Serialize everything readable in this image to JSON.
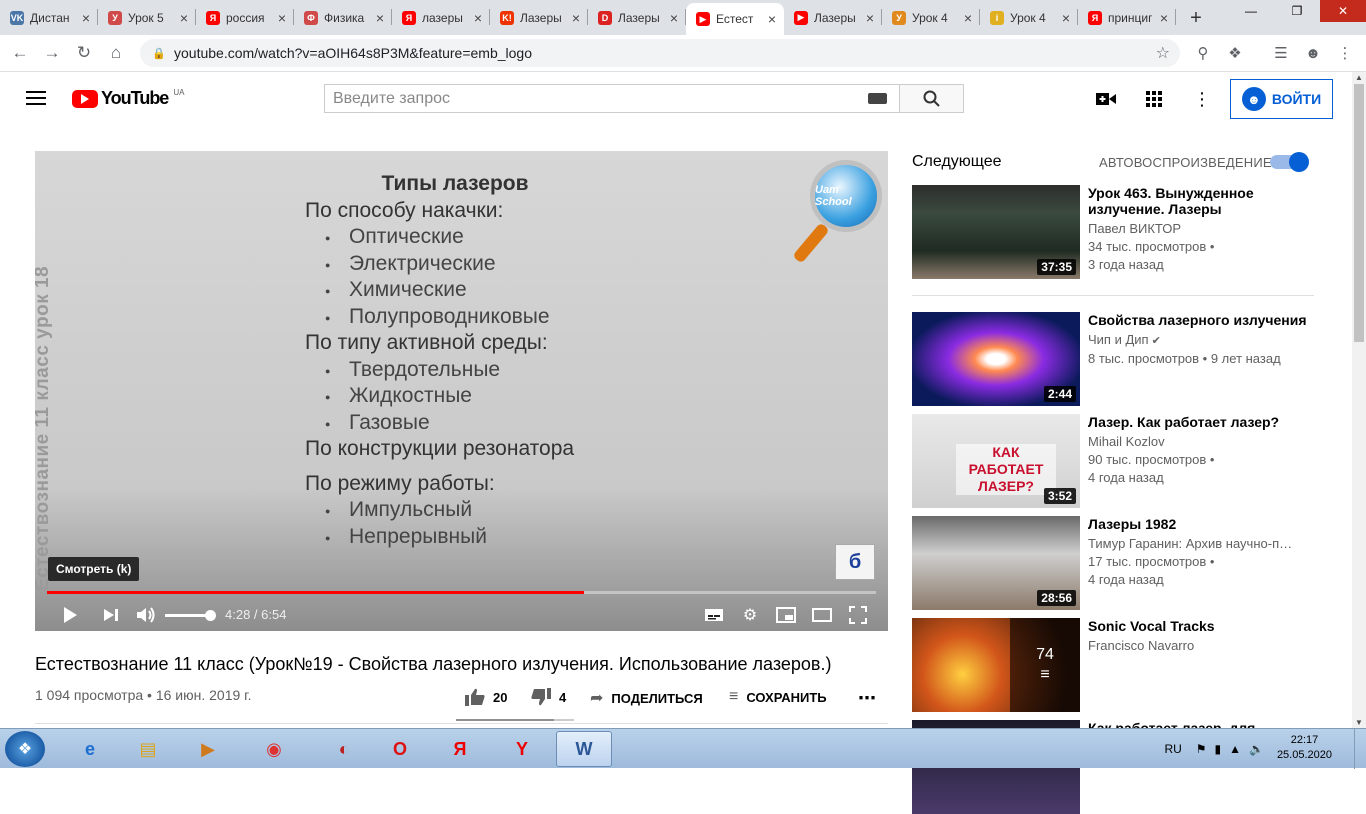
{
  "browser": {
    "tabs": [
      {
        "label": "Дистан",
        "icon": "vk-icon",
        "color": "#4a76a8",
        "glyph": "VK"
      },
      {
        "label": "Урок 5",
        "icon": "lesson-icon",
        "color": "#d04a4a",
        "glyph": "У"
      },
      {
        "label": "россия",
        "icon": "yandex-icon",
        "color": "#f00",
        "glyph": "Я"
      },
      {
        "label": "Физика",
        "icon": "lesson-icon",
        "color": "#d04a4a",
        "glyph": "Ф"
      },
      {
        "label": "лазеры",
        "icon": "yandex-icon",
        "color": "#f00",
        "glyph": "Я"
      },
      {
        "label": "Лазеры",
        "icon": "kinopoisk-icon",
        "color": "#e30",
        "glyph": "K!"
      },
      {
        "label": "Лазеры",
        "icon": "d-icon",
        "color": "#d22",
        "glyph": "D"
      },
      {
        "label": "Естест",
        "icon": "youtube-icon",
        "color": "#f00",
        "glyph": "▶",
        "active": true
      },
      {
        "label": "Лазеры",
        "icon": "youtube-icon",
        "color": "#f00",
        "glyph": "▶"
      },
      {
        "label": "Урок 4",
        "icon": "lesson-icon",
        "color": "#e08a1e",
        "glyph": "У"
      },
      {
        "label": "Урок 4",
        "icon": "pencil-icon",
        "color": "#e0b020",
        "glyph": "i"
      },
      {
        "label": "принцип",
        "icon": "yandex-icon",
        "color": "#f00",
        "glyph": "Я"
      }
    ],
    "url": "youtube.com/watch?v=aOIH64s8P3M&feature=emb_logo"
  },
  "header": {
    "logo_text": "YouTube",
    "region": "UA",
    "search_placeholder": "Введите запрос",
    "signin_label": "ВОЙТИ"
  },
  "player": {
    "slide_title": "Типы лазеров",
    "sections": [
      {
        "heading": "По способу накачки:",
        "items": [
          "Оптические",
          "Электрические",
          "Химические",
          "Полупроводниковые"
        ]
      },
      {
        "heading": "По типу активной среды:",
        "items": [
          "Твердотельные",
          "Жидкостные",
          "Газовые"
        ]
      },
      {
        "heading": "По конструкции резонатора",
        "items": []
      },
      {
        "heading": "По режиму работы:",
        "items": [
          "Импульсный",
          "Непрерывный"
        ]
      }
    ],
    "vertical_caption": "Естествознание 11 класс урок 18",
    "logo_text": "Uam School",
    "tooltip": "Смотреть (k)",
    "time": "4:28 / 6:54",
    "progress": 0.648,
    "volume": 1.0
  },
  "video": {
    "title": "Естествознание 11 класс (Урок№19 - Свойства лазерного излучения. Использование лазеров.)",
    "meta": "1 094 просмотра • 16 июн. 2019 г.",
    "likes": "20",
    "dislikes": "4",
    "share_label": "ПОДЕЛИТЬСЯ",
    "save_label": "СОХРАНИТЬ"
  },
  "sidebar": {
    "up_next_label": "Следующее",
    "autoplay_label": "АВТОВОСПРОИЗВЕДЕНИЕ",
    "autoplay_on": true,
    "videos": [
      {
        "title": "Урок 463. Вынужденное излучение. Лазеры",
        "channel": "Павел ВИКТОР",
        "views": "34 тыс. просмотров •",
        "age": "3 года назад",
        "duration": "37:35"
      },
      {
        "title": "Свойства лазерного излучения",
        "channel": "Чип и Дип",
        "verified": true,
        "views": "8 тыс. просмотров • 9 лет назад",
        "age": "",
        "duration": "2:44"
      },
      {
        "title": "Лазер. Как работает лазер?",
        "channel": "Mihail Kozlov",
        "views": "90 тыс. просмотров •",
        "age": "4 года назад",
        "duration": "3:52",
        "thumb_text": "КАК РАБОТАЕТ ЛАЗЕР?"
      },
      {
        "title": "Лазеры 1982",
        "channel": "Тимур Гаранин: Архив научно-п…",
        "views": "17 тыс. просмотров •",
        "age": "4 года назад",
        "duration": "28:56"
      },
      {
        "title": "Sonic Vocal Tracks",
        "channel": "Francisco Navarro",
        "views": "",
        "age": "",
        "duration": "",
        "playlist_count": "74"
      },
      {
        "title": "Как работает лазер, для",
        "channel": "",
        "views": "",
        "age": "",
        "duration": ""
      }
    ]
  },
  "taskbar": {
    "apps": [
      "ie-icon",
      "explorer-icon",
      "media-icon",
      "chrome-icon",
      "opera-alt-icon",
      "opera-icon",
      "yandex-icon",
      "yandex-browser-icon",
      "word-icon"
    ],
    "lang": "RU",
    "time": "22:17",
    "date": "25.05.2020"
  }
}
